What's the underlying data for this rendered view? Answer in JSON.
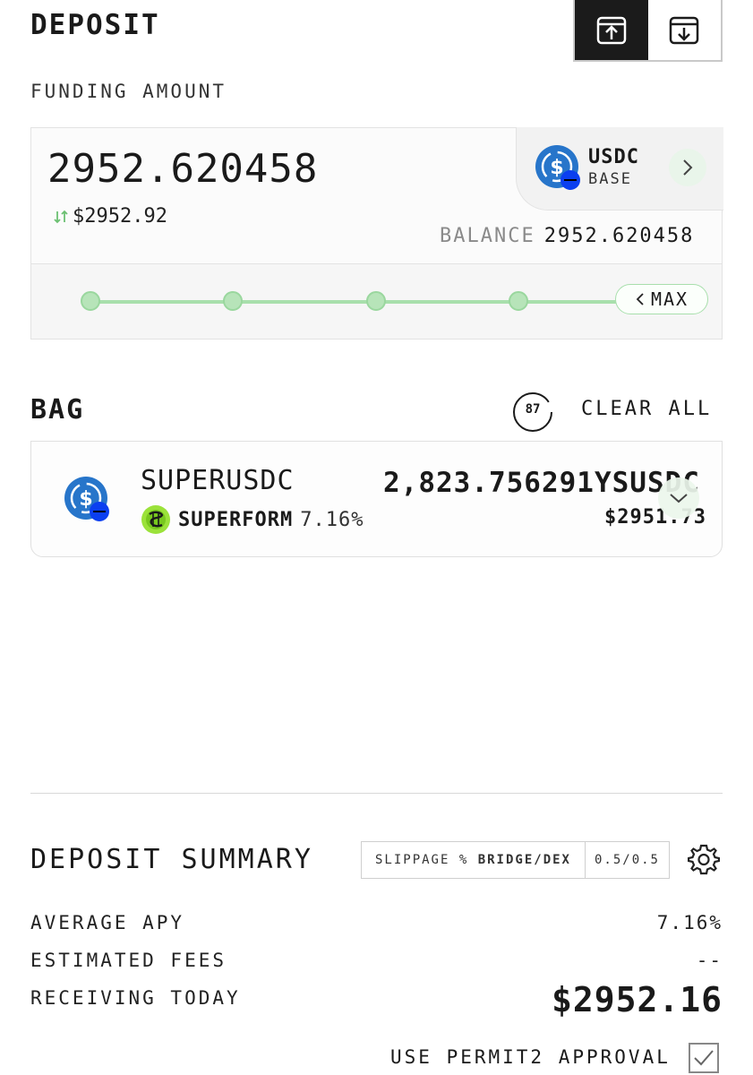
{
  "header": {
    "title": "DEPOSIT",
    "funding_label": "FUNDING AMOUNT"
  },
  "funding": {
    "amount": "2952.620458",
    "usd_value": "$2952.92",
    "balance_label": "BALANCE",
    "balance_value": "2952.620458",
    "token": {
      "symbol": "USDC",
      "chain": "BASE",
      "icon": "usdc-base-icon"
    },
    "max_label": "MAX"
  },
  "bag": {
    "title": "BAG",
    "count": "87",
    "clear_label": "CLEAR ALL",
    "items": [
      {
        "name": "SUPERUSDC",
        "protocol": "SUPERFORM",
        "apy": "7.16%",
        "amount": "2,823.756291",
        "symbol": "YSUSDC",
        "usd": "$2951.73"
      }
    ]
  },
  "summary": {
    "title": "DEPOSIT SUMMARY",
    "slippage_prefix": "SLIPPAGE % ",
    "slippage_mode": "BRIDGE/DEX",
    "slippage_value": "0.5/0.5",
    "rows": [
      {
        "label": "AVERAGE APY",
        "value": "7.16%"
      },
      {
        "label": "ESTIMATED FEES",
        "value": "--"
      },
      {
        "label": "RECEIVING TODAY",
        "value": "$2952.16"
      }
    ],
    "permit_label": "USE PERMIT2 APPROVAL",
    "permit_checked": true
  },
  "colors": {
    "accent_green": "#a8dfac",
    "usdc_blue": "#2775ca",
    "dark": "#1b1b1b"
  }
}
